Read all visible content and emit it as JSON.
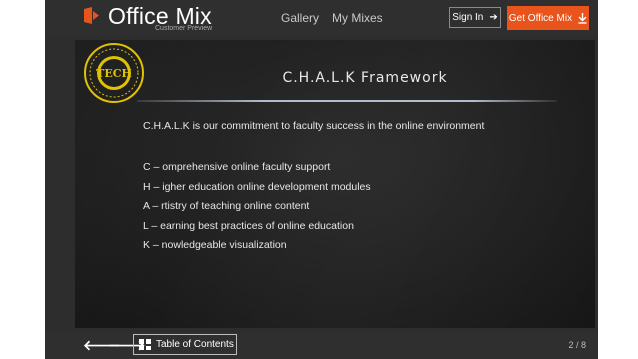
{
  "header": {
    "brand": "Office Mix",
    "brand_sub": "Customer Preview",
    "nav": [
      "Gallery",
      "My Mixes"
    ],
    "sign_in_label": "Sign In",
    "get_mix_label": "Get Office Mix",
    "accent_color": "#e8541c"
  },
  "slide": {
    "title": "C.H.A.L.K Framework",
    "intro": "C.H.A.L.K is our commitment to faculty success in the online environment",
    "items": [
      "C – omprehensive online faculty support",
      "H – igher education online development modules",
      "A – rtistry of teaching online content",
      "L – earning best practices of online education",
      "K – nowledgeable visualization"
    ],
    "badge_text": "TECH"
  },
  "footer": {
    "prev_icon": "arrow-left",
    "next_icon": "arrow-right",
    "toc_label": "Table of Contents",
    "page_counter": "2 / 8"
  }
}
